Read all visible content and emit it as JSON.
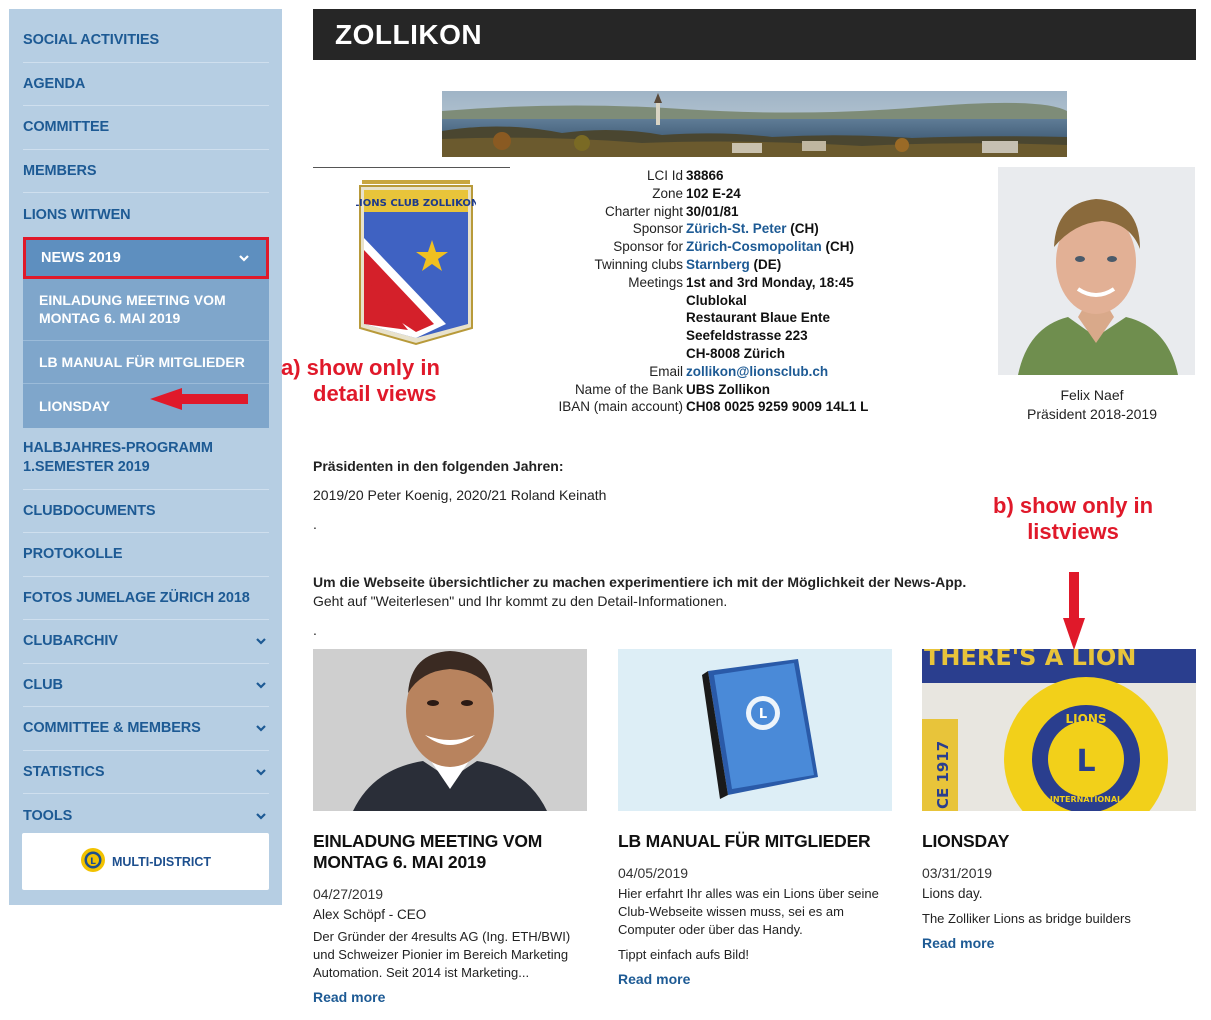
{
  "sidebar": {
    "items_top": [
      {
        "label": "SOCIAL ACTIVITIES"
      },
      {
        "label": "AGENDA"
      },
      {
        "label": "COMMITTEE"
      },
      {
        "label": "MEMBERS"
      },
      {
        "label": "LIONS WITWEN"
      }
    ],
    "active": {
      "label": "NEWS 2019"
    },
    "sub_items": [
      {
        "label": "EINLADUNG MEETING VOM MONTAG 6. MAI 2019"
      },
      {
        "label": "LB MANUAL FÜR MITGLIEDER"
      },
      {
        "label": "LIONSDAY"
      }
    ],
    "items_bottom": [
      {
        "label": "HALBJAHRES-PROGRAMM 1.SEMESTER 2019"
      },
      {
        "label": "CLUBDOCUMENTS"
      },
      {
        "label": "PROTOKOLLE"
      },
      {
        "label": "FOTOS JUMELAGE ZÜRICH 2018"
      },
      {
        "label": "CLUBARCHIV"
      },
      {
        "label": "CLUB"
      },
      {
        "label": "COMMITTEE & MEMBERS"
      },
      {
        "label": "STATISTICS"
      },
      {
        "label": "TOOLS"
      }
    ],
    "multi_district": "MULTI-DISTRICT"
  },
  "annotations": {
    "a_line1": "a)  show only in",
    "a_line2": "detail views",
    "b_line1": "b) show only in",
    "b_line2": "listviews"
  },
  "page": {
    "title": "ZOLLIKON",
    "pennant_text": "LIONS CLUB ZOLLIKON"
  },
  "info": {
    "lci_label": "LCI Id",
    "lci_value": "38866",
    "zone_label": "Zone",
    "zone_value": "102 E-24",
    "charter_label": "Charter night",
    "charter_value": "30/01/81",
    "sponsor_label": "Sponsor",
    "sponsor_link": "Zürich-St. Peter",
    "sponsor_suffix": "(CH)",
    "sponsor_for_label": "Sponsor for",
    "sponsor_for_link": "Zürich-Cosmopolitan",
    "sponsor_for_suffix": "(CH)",
    "twinning_label": "Twinning clubs",
    "twinning_link": "Starnberg",
    "twinning_suffix": "(DE)",
    "meetings_label": "Meetings",
    "meetings_lines": [
      "1st and 3rd Monday, 18:45",
      "Clublokal",
      "Restaurant Blaue Ente",
      "Seefeldstrasse 223",
      "CH-8008 Zürich"
    ],
    "email_label": "Email",
    "email_value": "zollikon@lionsclub.ch",
    "bank_label": "Name of the Bank",
    "bank_value": "UBS Zollikon",
    "iban_label": "IBAN (main account)",
    "iban_value": "CH08 0025 9259 9009 14L1 L"
  },
  "president": {
    "name": "Felix Naef",
    "role": "Präsident 2018-2019"
  },
  "content": {
    "presidents_heading": "Präsidenten in den folgenden Jahren:",
    "presidents_text": "2019/20 Peter Koenig, 2020/21 Roland Keinath",
    "dot1": ".",
    "intro_bold": "Um die Webseite übersichtlicher zu machen experimentiere ich mit der Möglichkeit der News-App.",
    "intro_text": "Geht auf \"Weiterlesen\" und Ihr kommt zu den Detail-Informationen.",
    "dot2": "."
  },
  "cards": [
    {
      "title": "EINLADUNG MEETING VOM MONTAG 6. MAI 2019",
      "date": "04/27/2019",
      "meta": "Alex Schöpf - CEO",
      "text": "Der Gründer der 4results AG (Ing. ETH/BWI) und Schweizer Pionier im Bereich Marketing Automation. Seit 2014 ist Marketing...",
      "text2": "",
      "read_more": "Read more"
    },
    {
      "title": "LB MANUAL FÜR MITGLIEDER",
      "date": "04/05/2019",
      "meta": "",
      "text": "Hier erfahrt Ihr alles was ein Lions über seine Club-Webseite wissen muss, sei es am Computer oder über das Handy.",
      "text2": "Tippt einfach aufs Bild!",
      "read_more": "Read more"
    },
    {
      "title": "LIONSDAY",
      "date": "03/31/2019",
      "meta": "Lions day.",
      "text": "The Zolliker Lions as bridge builders",
      "text2": "",
      "read_more": "Read more",
      "image_text_top": "THERE'S A LION",
      "image_text_side": "CE 1917",
      "emblem_top": "LIONS",
      "emblem_bottom": "INTERNATIONAL",
      "emblem_letter": "L"
    }
  ],
  "colors": {
    "sidebar_bg": "#b6cee3",
    "nav_text": "#1d5a94",
    "title_bar": "#262626",
    "annotation_red": "#e0192a"
  }
}
